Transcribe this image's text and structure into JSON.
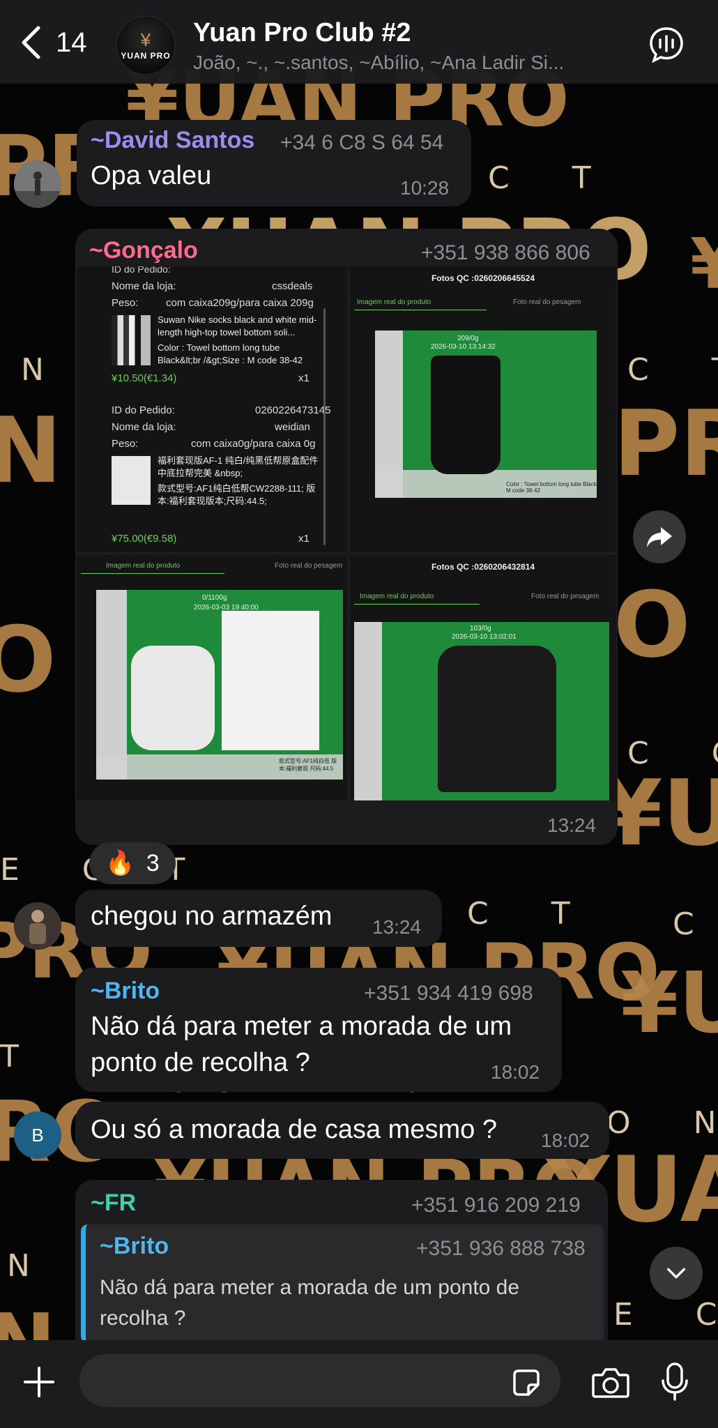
{
  "header": {
    "back_count": "14",
    "title": "Yuan Pro Club #2",
    "subtitle": "João, ~., ~.santos, ~Abílio, ~Ana Ladir Si...",
    "avatar_label": "YUAN PRO",
    "avatar_mark": "¥"
  },
  "wallpaper": {
    "brand": "¥UAN PRO",
    "connect": "CONNECT"
  },
  "messages": {
    "m1": {
      "sender": "~David Santos",
      "phone": "+34 6 C8 S 64 54",
      "text": "Opa valeu",
      "time": "10:28",
      "sender_color": "#9d8cf0"
    },
    "m2": {
      "sender": "~Gonçalo",
      "phone": "+351 938 866 806",
      "time": "13:24",
      "sender_color": "#ff6b8f"
    },
    "m3": {
      "text": "chegou no armazém",
      "time": "13:24"
    },
    "m4": {
      "sender": "~Brito",
      "phone": "+351 934 419 698",
      "text_line1": "Não dá para meter a morada de um",
      "text_line2": "ponto de recolha ?",
      "time": "18:02",
      "sender_color": "#4fb6f0"
    },
    "m5": {
      "avatar_letter": "B",
      "text": "Ou só a morada de casa mesmo ?",
      "time": "18:02"
    },
    "m6": {
      "sender": "~FR",
      "phone": "+351 916 209 219",
      "sender_color": "#3fd0a8",
      "reply_sender": "~Brito",
      "reply_phone": "+351 936 888 738",
      "reply_line1": "Não dá para meter a morada de um ponto de",
      "reply_line2": "recolha ?"
    }
  },
  "reaction": {
    "emoji": "🔥",
    "count": "3"
  },
  "order_card": {
    "o1_label_id": "ID do Pedido:",
    "o1_label_store": "Nome da loja:",
    "o1_store": "cssdeals",
    "o1_label_weight": "Peso:",
    "o1_weight": "com caixa209g/para caixa 209g",
    "o1_desc": "Suwan Nike socks black and white mid-length high-top towel bottom soli...",
    "o1_color": "Color : Towel bottom long tube Black&lt;br /&gt;Size : M code 38-42",
    "o1_price": "¥10.50(€1.34)",
    "o1_qty": "x1",
    "o2_label_id": "ID do Pedido:",
    "o2_id": "0260226473145",
    "o2_label_store": "Nome da loja:",
    "o2_store": "weidian",
    "o2_label_weight": "Peso:",
    "o2_weight": "com caixa0g/para caixa 0g",
    "o2_desc": "福利套现版AF-1 纯白/纯黑低帮原盒配件 中底拉帮完美 &nbsp;",
    "o2_model": "款式型号:AF1纯白低帮CW2288-111; 版本:福利套现版本;尺码:44.5;",
    "o2_price": "¥75.00(€9.58)",
    "o2_qty": "x1"
  },
  "qc": {
    "title1": "Fotos QC :0260206645524",
    "title2": "Fotos QC :0260206432814",
    "tab_product": "Imagem real do produto",
    "tab_weight": "Foto real do pesagem",
    "socks_stamp": "2026-03-10 13:14:32",
    "socks_weight": "209/0g",
    "shoes_stamp": "2026-03-03 19:40:00",
    "shoes_weight": "0/1100g",
    "shirt_stamp": "2026-03-10 13:02:01",
    "shirt_weight": "103/0g",
    "socks_tag": "Color : Towel bottom long tube Black M code 38-42",
    "shoes_tag": "款式型号:AF1纯白低 版本:福利套现 尺码:44.5"
  },
  "colors": {
    "bubble": "#1c1c1e",
    "accent_gold": "#b8864a",
    "qc_green": "#1f8a3a"
  }
}
